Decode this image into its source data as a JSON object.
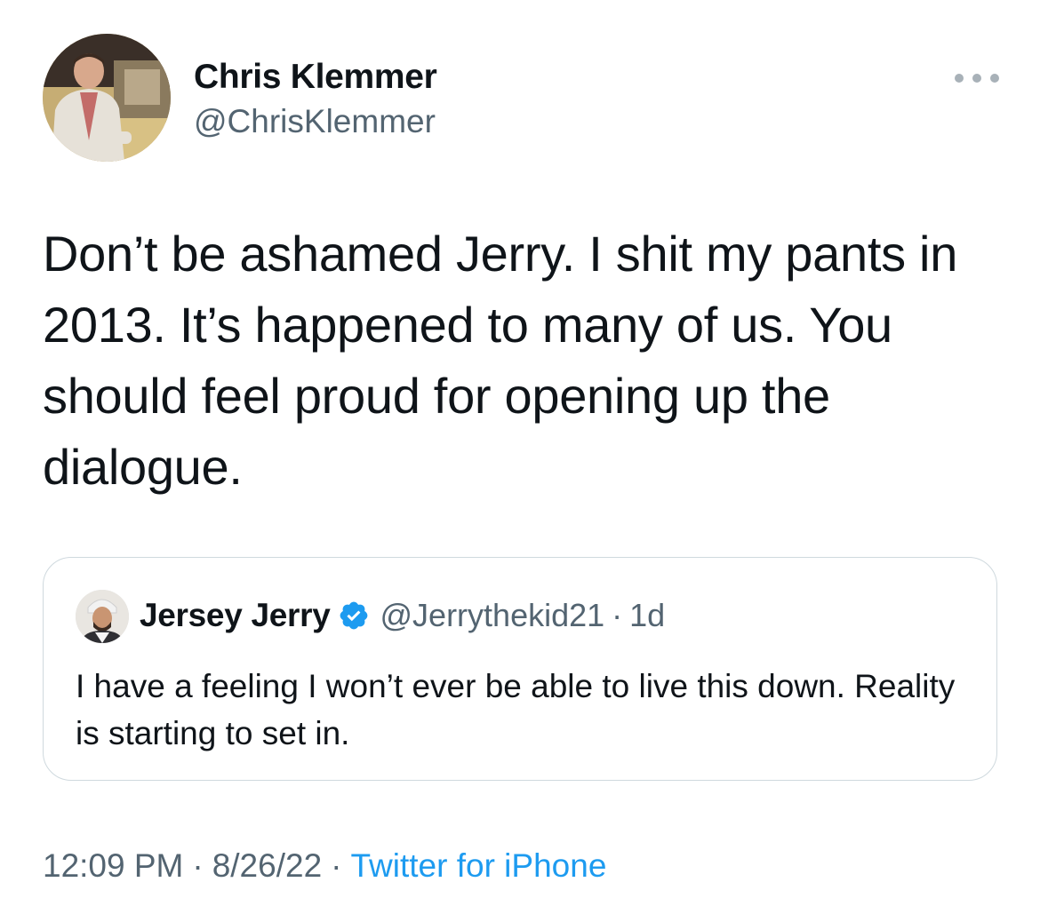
{
  "author": {
    "display_name": "Chris Klemmer",
    "handle": "@ChrisKlemmer",
    "avatar_icon": "profile-photo"
  },
  "more_icon": "ellipsis-icon",
  "tweet": {
    "text": "Don’t be ashamed Jerry. I shit my pants in 2013. It’s happened to many of us. You should feel proud for opening up the dialogue."
  },
  "quoted_tweet": {
    "display_name": "Jersey Jerry",
    "verified": true,
    "handle": "@Jerrythekid21",
    "separator": "·",
    "time": "1d",
    "text": "I have a feeling I won’t ever be able to live this down. Reality is starting to set in."
  },
  "footer": {
    "time": "12:09 PM",
    "sep1": "·",
    "date": "8/26/22",
    "sep2": "·",
    "source": "Twitter for iPhone"
  },
  "colors": {
    "text_primary": "#0f1419",
    "text_secondary": "#536471",
    "link": "#1d9bf0",
    "border": "#cfd9de",
    "verified_badge": "#1d9bf0"
  }
}
